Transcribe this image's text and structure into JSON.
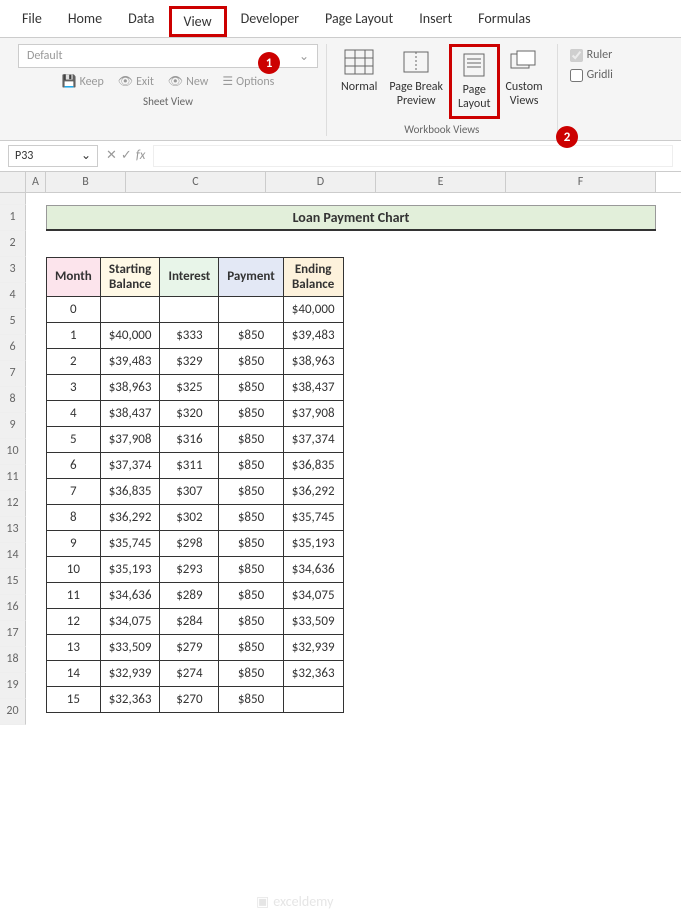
{
  "tabs": {
    "file": "File",
    "home": "Home",
    "data": "Data",
    "view": "View",
    "developer": "Developer",
    "pageLayout": "Page Layout",
    "insert": "Insert",
    "formulas": "Formulas"
  },
  "sheetView": {
    "dropdown": "Default",
    "keep": "Keep",
    "exit": "Exit",
    "new": "New",
    "options": "Options",
    "label": "Sheet View"
  },
  "workbookViews": {
    "normal": "Normal",
    "pageBreak": "Page Break\nPreview",
    "pageLayout": "Page\nLayout",
    "custom": "Custom\nViews",
    "label": "Workbook Views"
  },
  "show": {
    "ruler": "Ruler",
    "gridlines": "Gridli"
  },
  "callouts": {
    "c1": "1",
    "c2": "2"
  },
  "nameBox": "P33",
  "fx": "fx",
  "cols": {
    "A": "A",
    "B": "B",
    "C": "C",
    "D": "D",
    "E": "E",
    "F": "F"
  },
  "title": "Loan Payment Chart",
  "headers": {
    "month": "Month",
    "start": "Starting Balance",
    "interest": "Interest",
    "payment": "Payment",
    "end": "Ending Balance"
  },
  "rows": [
    {
      "n": "1"
    },
    {
      "n": "2"
    },
    {
      "n": "3"
    },
    {
      "n": "4"
    },
    {
      "n": "5"
    },
    {
      "n": "6"
    },
    {
      "n": "7"
    },
    {
      "n": "8"
    },
    {
      "n": "9"
    },
    {
      "n": "10"
    },
    {
      "n": "11"
    },
    {
      "n": "12"
    },
    {
      "n": "13"
    },
    {
      "n": "14"
    },
    {
      "n": "15"
    },
    {
      "n": "16"
    },
    {
      "n": "17"
    },
    {
      "n": "18"
    },
    {
      "n": "19"
    },
    {
      "n": "20"
    }
  ],
  "chart_data": {
    "type": "table",
    "title": "Loan Payment Chart",
    "columns": [
      "Month",
      "Starting Balance",
      "Interest",
      "Payment",
      "Ending Balance"
    ],
    "data": [
      {
        "month": "0",
        "start": "",
        "interest": "",
        "payment": "",
        "end": "$40,000"
      },
      {
        "month": "1",
        "start": "$40,000",
        "interest": "$333",
        "payment": "$850",
        "end": "$39,483"
      },
      {
        "month": "2",
        "start": "$39,483",
        "interest": "$329",
        "payment": "$850",
        "end": "$38,963"
      },
      {
        "month": "3",
        "start": "$38,963",
        "interest": "$325",
        "payment": "$850",
        "end": "$38,437"
      },
      {
        "month": "4",
        "start": "$38,437",
        "interest": "$320",
        "payment": "$850",
        "end": "$37,908"
      },
      {
        "month": "5",
        "start": "$37,908",
        "interest": "$316",
        "payment": "$850",
        "end": "$37,374"
      },
      {
        "month": "6",
        "start": "$37,374",
        "interest": "$311",
        "payment": "$850",
        "end": "$36,835"
      },
      {
        "month": "7",
        "start": "$36,835",
        "interest": "$307",
        "payment": "$850",
        "end": "$36,292"
      },
      {
        "month": "8",
        "start": "$36,292",
        "interest": "$302",
        "payment": "$850",
        "end": "$35,745"
      },
      {
        "month": "9",
        "start": "$35,745",
        "interest": "$298",
        "payment": "$850",
        "end": "$35,193"
      },
      {
        "month": "10",
        "start": "$35,193",
        "interest": "$293",
        "payment": "$850",
        "end": "$34,636"
      },
      {
        "month": "11",
        "start": "$34,636",
        "interest": "$289",
        "payment": "$850",
        "end": "$34,075"
      },
      {
        "month": "12",
        "start": "$34,075",
        "interest": "$284",
        "payment": "$850",
        "end": "$33,509"
      },
      {
        "month": "13",
        "start": "$33,509",
        "interest": "$279",
        "payment": "$850",
        "end": "$32,939"
      },
      {
        "month": "14",
        "start": "$32,939",
        "interest": "$274",
        "payment": "$850",
        "end": "$32,363"
      },
      {
        "month": "15",
        "start": "$32,363",
        "interest": "$270",
        "payment": "$850",
        "end": ""
      }
    ]
  },
  "watermark": "exceldemy"
}
